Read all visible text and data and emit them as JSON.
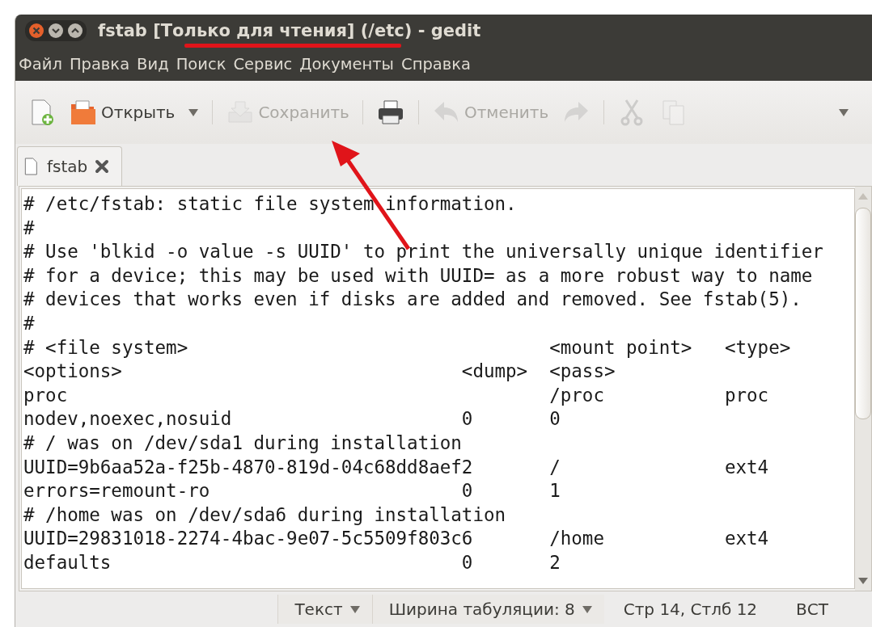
{
  "window": {
    "title": "fstab [Только для чтения] (/etc) - gedit"
  },
  "menu": [
    "Файл",
    "Правка",
    "Вид",
    "Поиск",
    "Сервис",
    "Документы",
    "Справка"
  ],
  "toolbar": [
    {
      "kind": "new",
      "disabled": false
    },
    {
      "kind": "open",
      "label": "Открыть",
      "disabled": false
    },
    {
      "kind": "dropdown",
      "disabled": false
    },
    {
      "kind": "separator"
    },
    {
      "kind": "save",
      "label": "Сохранить",
      "disabled": true
    },
    {
      "kind": "separator"
    },
    {
      "kind": "print",
      "disabled": false
    },
    {
      "kind": "separator"
    },
    {
      "kind": "undo",
      "label": "Отменить",
      "disabled": true
    },
    {
      "kind": "redo",
      "disabled": true
    },
    {
      "kind": "separator"
    },
    {
      "kind": "cut",
      "disabled": true
    },
    {
      "kind": "copy",
      "disabled": true
    },
    {
      "kind": "overflow",
      "disabled": false
    }
  ],
  "tabs": [
    {
      "label": "fstab",
      "selected": true
    }
  ],
  "editor": {
    "lines": [
      "# /etc/fstab: static file system information.",
      "#",
      "# Use 'blkid -o value -s UUID' to print the universally unique identifier",
      "# for a device; this may be used with UUID= as a more robust way to name",
      "# devices that works even if disks are added and removed. See fstab(5).",
      "#",
      "# <file system>                                 <mount point>   <type>",
      "<options>                               <dump>  <pass>",
      "proc                                            /proc           proc",
      "nodev,noexec,nosuid                     0       0",
      "# / was on /dev/sda1 during installation",
      "UUID=9b6aa52a-f25b-4870-819d-04c68dd8aef2       /               ext4",
      "errors=remount-ro                       0       1",
      "# /home was on /dev/sda6 during installation",
      "UUID=29831018-2274-4bac-9e07-5c5509f803c6       /home           ext4",
      "defaults                                0       2"
    ]
  },
  "status_bar": {
    "language": "Текст",
    "tab_width": "Ширина табуляции:  8",
    "position": "Стр 14, Стлб 12",
    "mode": "ВСТ"
  }
}
